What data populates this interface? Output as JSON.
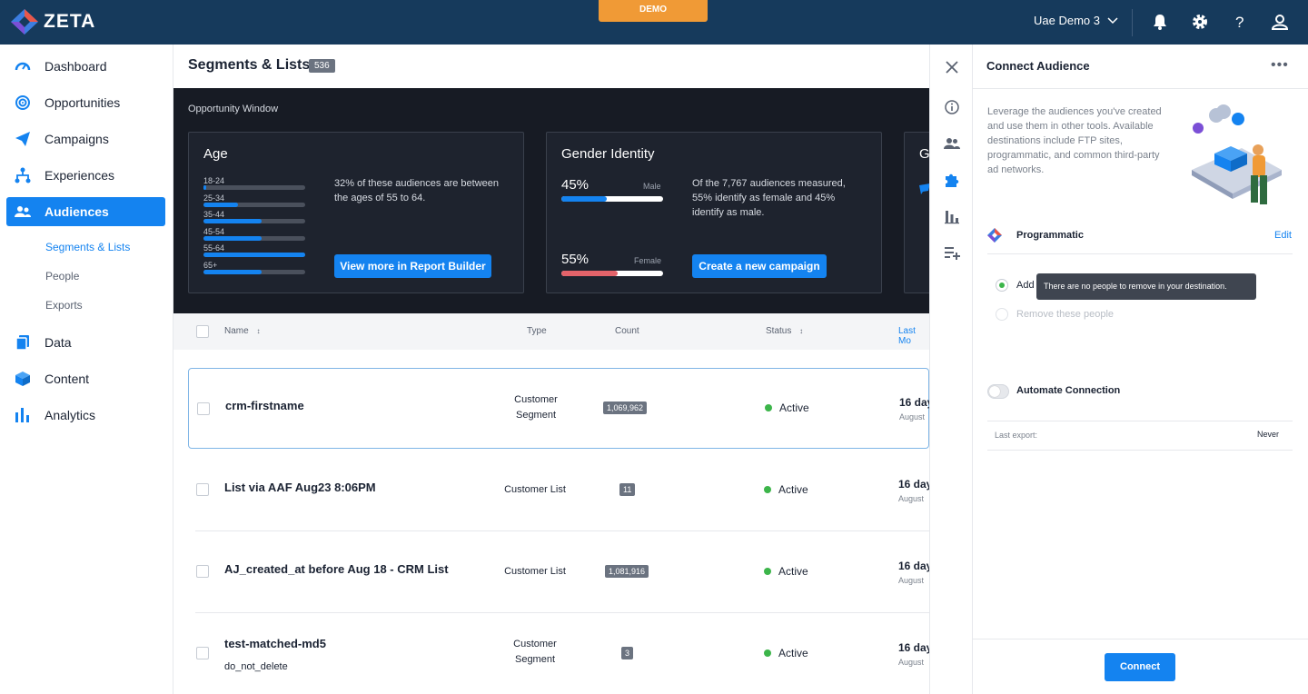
{
  "app": {
    "brand": "ZETA",
    "demo_label": "DEMO",
    "account": "Uae Demo 3"
  },
  "sidebar": {
    "items": [
      {
        "label": "Dashboard",
        "icon": "gauge-icon"
      },
      {
        "label": "Opportunities",
        "icon": "target-icon"
      },
      {
        "label": "Campaigns",
        "icon": "paper-plane-icon"
      },
      {
        "label": "Experiences",
        "icon": "hierarchy-icon"
      },
      {
        "label": "Audiences",
        "icon": "users-icon"
      },
      {
        "label": "Data",
        "icon": "stack-icon"
      },
      {
        "label": "Content",
        "icon": "cube-icon"
      },
      {
        "label": "Analytics",
        "icon": "bar-chart-icon"
      }
    ],
    "sub_items": [
      "Segments & Lists",
      "People",
      "Exports"
    ]
  },
  "page": {
    "title": "Segments & Lists",
    "count": "536"
  },
  "opportunity": {
    "title": "Opportunity Window",
    "age": {
      "title": "Age",
      "bars": [
        {
          "label": "18-24",
          "value": 0.03
        },
        {
          "label": "25-34",
          "value": 0.34
        },
        {
          "label": "35-44",
          "value": 0.57
        },
        {
          "label": "45-54",
          "value": 0.57
        },
        {
          "label": "55-64",
          "value": 1.0
        },
        {
          "label": "65+",
          "value": 0.57
        }
      ],
      "desc": "32% of these audiences are between the ages of 55 to 64.",
      "button": "View more in Report Builder"
    },
    "gender": {
      "title": "Gender Identity",
      "male_pct": "45%",
      "male_label": "Male",
      "male_value": 0.45,
      "female_pct": "55%",
      "female_label": "Female",
      "female_value": 0.55,
      "desc": "Of the 7,767 audiences measured, 55% identify as female and 45% identify as male.",
      "button": "Create a new campaign"
    },
    "third_title": "G"
  },
  "table": {
    "headers": {
      "name": "Name",
      "type": "Type",
      "count": "Count",
      "status": "Status",
      "last_modified": "Last Mo"
    },
    "rows": [
      {
        "name": "crm-firstname",
        "sub": "",
        "type1": "Customer",
        "type2": "Segment",
        "count": "1,069,962",
        "status": "Active",
        "mod": "16 day",
        "mod_sub": "August"
      },
      {
        "name": "List via AAF Aug23 8:06PM",
        "sub": "",
        "type1": "Customer List",
        "type2": "",
        "count": "11",
        "status": "Active",
        "mod": "16 day",
        "mod_sub": "August"
      },
      {
        "name": "AJ_created_at before Aug 18 - CRM List",
        "sub": "",
        "type1": "Customer List",
        "type2": "",
        "count": "1,081,916",
        "status": "Active",
        "mod": "16 day",
        "mod_sub": "August"
      },
      {
        "name": "test-matched-md5",
        "sub": "do_not_delete",
        "type1": "Customer",
        "type2": "Segment",
        "count": "3",
        "status": "Active",
        "mod": "16 day",
        "mod_sub": "August"
      }
    ]
  },
  "panel": {
    "title": "Connect Audience",
    "description": "Leverage the audiences you've created and use them in other tools. Available destinations include FTP sites, programmatic, and common third-party ad networks.",
    "destination": "Programmatic",
    "edit": "Edit",
    "add_label": "Add",
    "remove_label": "Remove these people",
    "tooltip": "There are no people to remove in your destination.",
    "automate": "Automate Connection",
    "last_export_label": "Last export:",
    "last_export_value": "Never",
    "connect": "Connect"
  },
  "colors": {
    "accent": "#1483f0",
    "topbar": "#163a5c",
    "active": "#3cb54a",
    "demo": "#f09a36"
  }
}
